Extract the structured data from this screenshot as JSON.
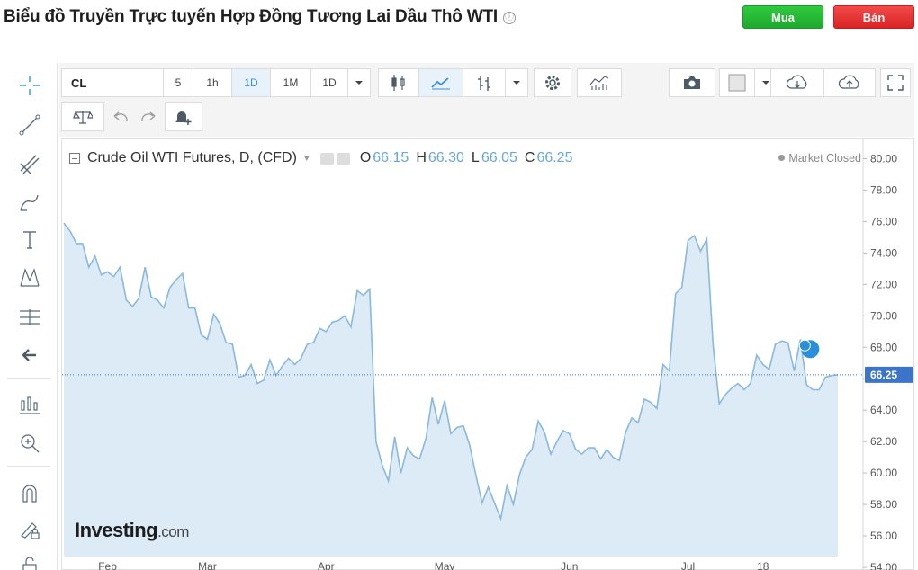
{
  "header": {
    "title": "Biểu đồ Truyền Trực tuyến Hợp Đồng Tương Lai Dầu Thô WTI",
    "info_icon": "ⓘ",
    "buy_label": "Mua",
    "sell_label": "Bán",
    "buy_color": "#27b636",
    "sell_color": "#e23232"
  },
  "toolbar": {
    "symbol": "CL",
    "intervals": [
      "5",
      "1h",
      "1D",
      "1M",
      "1D"
    ],
    "active_interval": "1D"
  },
  "legend": {
    "name": "Crude Oil WTI Futures, D, (CFD)",
    "ohlc": [
      {
        "key": "O",
        "value": "66.15"
      },
      {
        "key": "H",
        "value": "66.30"
      },
      {
        "key": "L",
        "value": "66.05"
      },
      {
        "key": "C",
        "value": "66.25"
      }
    ],
    "market_status": "Market Closed"
  },
  "brand": {
    "name": "Investing",
    "suffix": ".com"
  },
  "chart_data": {
    "type": "area",
    "title": "Crude Oil WTI Futures, D, (CFD)",
    "xlabel": "",
    "ylabel": "",
    "ylim": [
      54,
      81
    ],
    "yticks": [
      54,
      56,
      58,
      60,
      62,
      64,
      66,
      68,
      70,
      72,
      74,
      76,
      78,
      80
    ],
    "ytick_labels": [
      "54.00",
      "56.00",
      "58.00",
      "60.00",
      "62.00",
      "64.00",
      "66.00",
      "68.00",
      "70.00",
      "72.00",
      "74.00",
      "76.00",
      "78.00",
      "80.00"
    ],
    "xticks": [
      {
        "label": "Feb",
        "i": 7
      },
      {
        "label": "Mar",
        "i": 23
      },
      {
        "label": "Apr",
        "i": 42
      },
      {
        "label": "May",
        "i": 61
      },
      {
        "label": "Jun",
        "i": 81
      },
      {
        "label": "Jul",
        "i": 100
      },
      {
        "label": "18",
        "i": 112
      }
    ],
    "last_value": 66.25,
    "last_value_label": "66.25",
    "grid": false,
    "line_color": "#8ab8de",
    "fill_color": "#dcebf6",
    "label_bg": "#3c74c7",
    "series": [
      {
        "values": [
          75.9,
          75.4,
          74.6,
          74.6,
          73.1,
          73.8,
          72.6,
          72.8,
          72.5,
          73.1,
          71.0,
          70.6,
          71.1,
          73.1,
          71.2,
          71.0,
          70.5,
          71.8,
          72.3,
          72.7,
          70.5,
          70.5,
          68.8,
          68.5,
          70.1,
          69.5,
          68.3,
          68.2,
          66.1,
          66.2,
          66.9,
          65.7,
          65.9,
          67.2,
          66.2,
          66.8,
          67.3,
          66.9,
          67.3,
          68.2,
          68.3,
          69.2,
          69.0,
          69.6,
          69.7,
          70.0,
          69.3,
          71.6,
          71.3,
          71.7,
          62.0,
          60.5,
          59.5,
          62.3,
          60.0,
          61.6,
          61.1,
          60.9,
          62.2,
          64.8,
          63.1,
          64.6,
          62.5,
          62.9,
          63.0,
          61.8,
          59.9,
          58.1,
          59.1,
          58.1,
          57.1,
          59.2,
          58.0,
          59.9,
          61.0,
          61.5,
          63.3,
          62.6,
          61.2,
          62.0,
          62.7,
          62.5,
          61.5,
          61.2,
          61.6,
          61.6,
          60.9,
          61.5,
          61.0,
          60.8,
          62.6,
          63.5,
          63.2,
          64.7,
          64.5,
          64.1,
          66.9,
          66.5,
          71.4,
          71.8,
          74.8,
          75.1,
          74.1,
          74.9,
          68.2,
          64.4,
          65.0,
          65.4,
          65.7,
          65.3,
          65.7,
          67.5,
          66.9,
          66.6,
          68.2,
          68.4,
          68.3,
          66.5,
          68.5,
          65.6,
          65.3,
          65.3,
          66.1,
          66.2,
          66.25
        ]
      }
    ]
  }
}
